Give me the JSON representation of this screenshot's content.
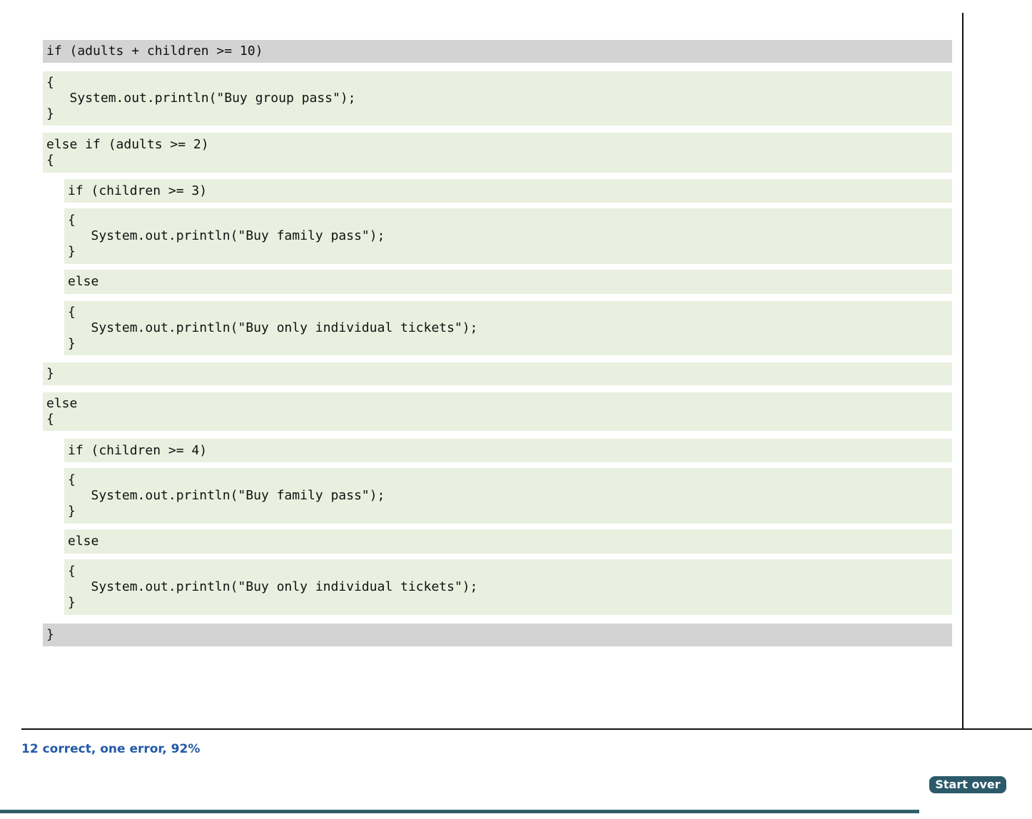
{
  "code_blocks": [
    {
      "lines": [
        "if (adults + children >= 10)"
      ]
    },
    {
      "lines": [
        "{",
        "   System.out.println(\"Buy group pass\");",
        "}"
      ]
    },
    {
      "lines": [
        "else if (adults >= 2)",
        "{"
      ]
    },
    {
      "lines": [
        "if (children >= 3)"
      ]
    },
    {
      "lines": [
        "{",
        "   System.out.println(\"Buy family pass\");",
        "}"
      ]
    },
    {
      "lines": [
        "else"
      ]
    },
    {
      "lines": [
        "{",
        "   System.out.println(\"Buy only individual tickets\");",
        "}"
      ]
    },
    {
      "lines": [
        "}"
      ]
    },
    {
      "lines": [
        "else",
        "{"
      ]
    },
    {
      "lines": [
        "if (children >= 4)"
      ]
    },
    {
      "lines": [
        "{",
        "   System.out.println(\"Buy family pass\");",
        "}"
      ]
    },
    {
      "lines": [
        "else"
      ]
    },
    {
      "lines": [
        "{",
        "   System.out.println(\"Buy only individual tickets\");",
        "}"
      ]
    },
    {
      "lines": [
        "}"
      ]
    }
  ],
  "feedback": {
    "score_text": "12 correct, one error, 92%"
  },
  "controls": {
    "start_over_label": "Start over"
  },
  "colors": {
    "block_green": "#e9f0df",
    "block_grey": "#d3d3d3",
    "score_blue": "#2459a8",
    "button_bg": "#2c5a6a"
  }
}
